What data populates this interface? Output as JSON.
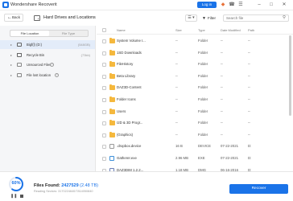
{
  "window": {
    "title": "Wondershare Recoverit",
    "login_label": "Log in",
    "icons": [
      "gift-icon",
      "headset-icon",
      "menu-icon",
      "minimize-icon",
      "maximize-icon",
      "close-icon"
    ]
  },
  "nav": {
    "back_label": "Back",
    "title": "Hard Drives and Locations",
    "filter_label": "Filter",
    "search_placeholder": "Search file"
  },
  "sidebar": {
    "tabs": [
      "File Location",
      "File Type"
    ],
    "active_tab": 0,
    "items": [
      {
        "label": "Bigf(l) (D:)",
        "size": "(548GB)",
        "selected": true
      },
      {
        "label": "Recycle Bin",
        "size": "(73kb)",
        "selected": false
      },
      {
        "label": "Unsourced Files",
        "size": "",
        "selected": false,
        "help": true
      },
      {
        "label": "File lost location",
        "size": "",
        "selected": false,
        "help": true
      }
    ]
  },
  "list": {
    "columns": {
      "name": "Name",
      "size": "Size",
      "type": "Type",
      "date": "Date Modified",
      "path": "Path"
    },
    "rows": [
      {
        "name": "System Volume I...",
        "size": "--",
        "type": "Folder",
        "date": "--",
        "path": "--",
        "kind": "folder"
      },
      {
        "name": "1SD Downloads",
        "size": "--",
        "type": "Folder",
        "date": "--",
        "path": "--",
        "kind": "folder"
      },
      {
        "name": "FileHistory",
        "size": "--",
        "type": "Folder",
        "date": "--",
        "path": "--",
        "kind": "folder"
      },
      {
        "name": "Beta Library",
        "size": "--",
        "type": "Folder",
        "date": "--",
        "path": "--",
        "kind": "folder"
      },
      {
        "name": "DAZ3D-Content",
        "size": "--",
        "type": "Folder",
        "date": "--",
        "path": "--",
        "kind": "folder"
      },
      {
        "name": "Folder Icons",
        "size": "--",
        "type": "Folder",
        "date": "--",
        "path": "--",
        "kind": "folder"
      },
      {
        "name": "Users",
        "size": "--",
        "type": "Folder",
        "date": "--",
        "path": "--",
        "kind": "folder"
      },
      {
        "name": "I2D & 3D Progr...",
        "size": "--",
        "type": "Folder",
        "date": "--",
        "path": "--",
        "kind": "folder"
      },
      {
        "name": "(Graphics)",
        "size": "--",
        "type": "Folder",
        "date": "--",
        "path": "--",
        "kind": "folder"
      },
      {
        "name": ".dropbox.device",
        "size": "16 B",
        "type": "DEVICE",
        "date": "07-22-2021",
        "path": "D:",
        "kind": "file"
      },
      {
        "name": "Gatherer.exe",
        "size": "2.96 MB",
        "type": "EXE",
        "date": "07-22-2021",
        "path": "D:",
        "kind": "exe"
      },
      {
        "name": "DAZ3DIM 1.2.2...",
        "size": "1.18 MB",
        "type": "DMG",
        "date": "06-16-2016",
        "path": "D:",
        "kind": "dmg"
      }
    ]
  },
  "footer": {
    "progress_percent": 60,
    "progress_label": "60%",
    "found_prefix": "Files Found: ",
    "found_count": "2427529",
    "found_size": " (2.48 TB)",
    "reading": "Reading Sectors: 3170224640/7814050840",
    "recover_label": "Recover"
  },
  "colors": {
    "accent": "#1a73e8",
    "folder": "#f5b83d",
    "sidebar_bg": "#f5f6f8",
    "selected_bg": "#e3ecf9"
  }
}
